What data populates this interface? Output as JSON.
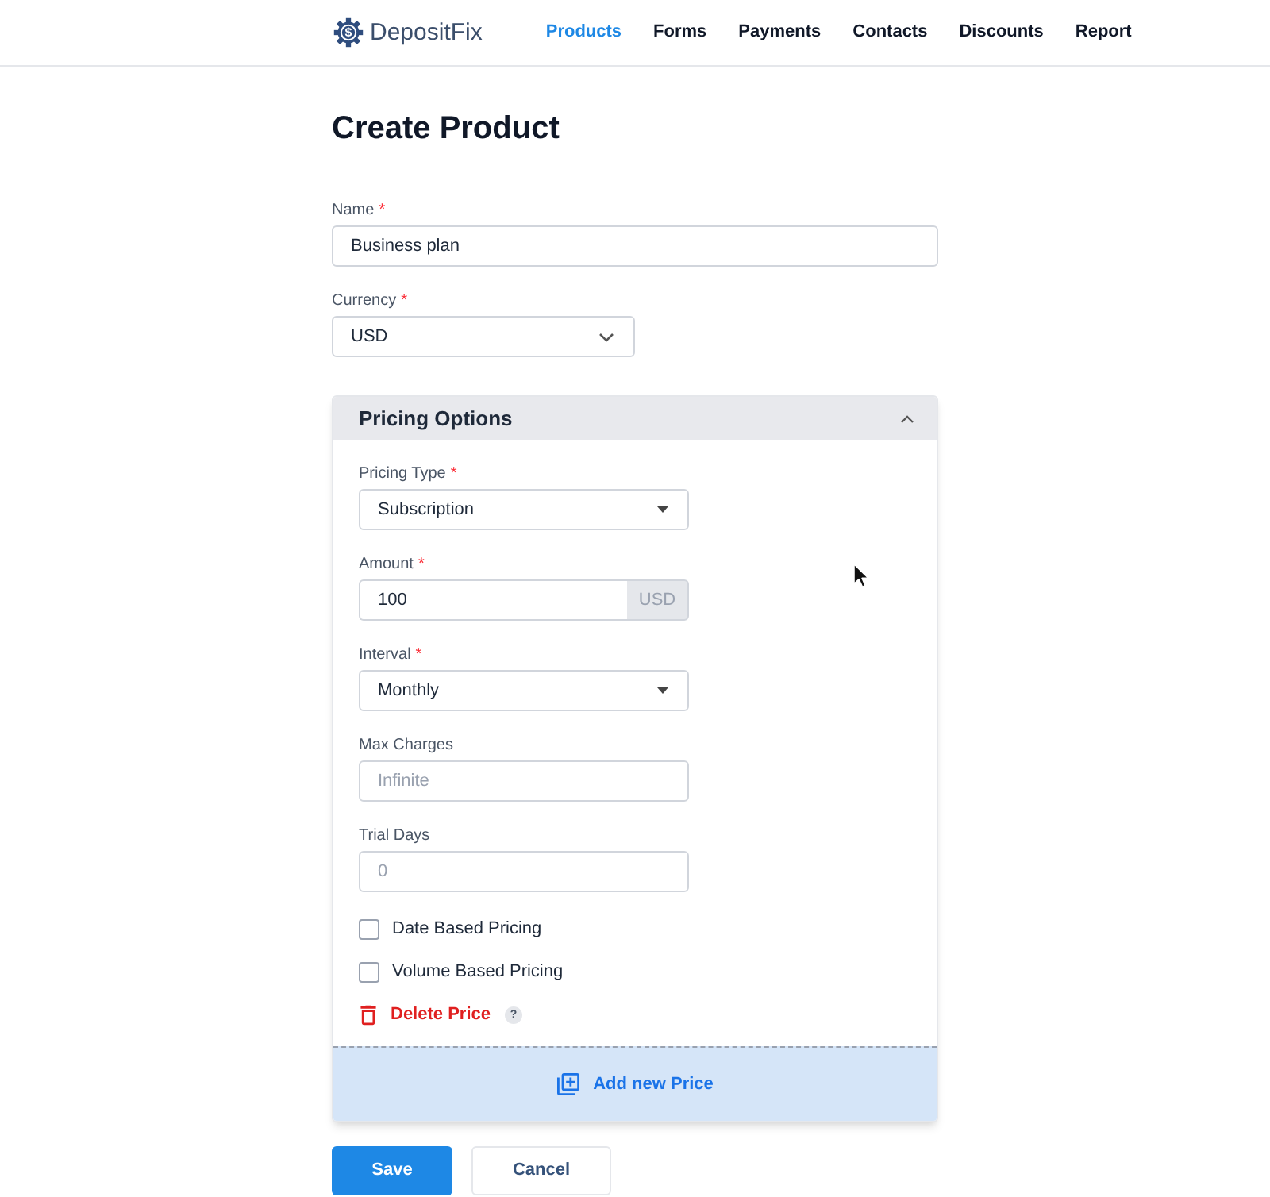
{
  "nav": {
    "logo": {
      "symbol": "$",
      "text": "DepositFix"
    },
    "items": [
      {
        "label": "Products",
        "selected": true
      },
      {
        "label": "Forms",
        "selected": false
      },
      {
        "label": "Payments",
        "selected": false
      },
      {
        "label": "Contacts",
        "selected": false
      },
      {
        "label": "Discounts",
        "selected": false
      },
      {
        "label": "Report",
        "selected": false
      }
    ]
  },
  "page_title": "Create Product",
  "fields": [
    {
      "label": "Name",
      "required_mark": "*",
      "kind": "text",
      "value": "Business plan"
    },
    {
      "label": "Currency",
      "required_mark": "*",
      "kind": "select",
      "value": "USD"
    }
  ],
  "pricing_options": {
    "title": "Pricing Options",
    "expanded": true,
    "fields": [
      {
        "label": "Pricing Type",
        "required_mark": "*",
        "kind": "dropdown",
        "value": "Subscription"
      },
      {
        "label": "Amount",
        "required_mark": "*",
        "kind": "addon",
        "value": "100",
        "addon": "USD"
      },
      {
        "label": "Interval",
        "required_mark": "*",
        "kind": "dropdown",
        "value": "Monthly"
      },
      {
        "label": "Max Charges",
        "kind": "text",
        "placeholder": "Infinite"
      },
      {
        "label": "Trial Days",
        "kind": "text",
        "placeholder": "0"
      }
    ],
    "checkboxes": [
      {
        "label": "Date Based Pricing",
        "checked": false
      },
      {
        "label": "Volume Based Pricing",
        "checked": false
      }
    ],
    "delete_link": {
      "label": "Delete Price",
      "help": "?"
    },
    "add_button": {
      "label": "Add new Price"
    }
  },
  "buttons": [
    {
      "label": "Save",
      "kind": "primary"
    },
    {
      "label": "Cancel",
      "kind": "secondary"
    }
  ]
}
